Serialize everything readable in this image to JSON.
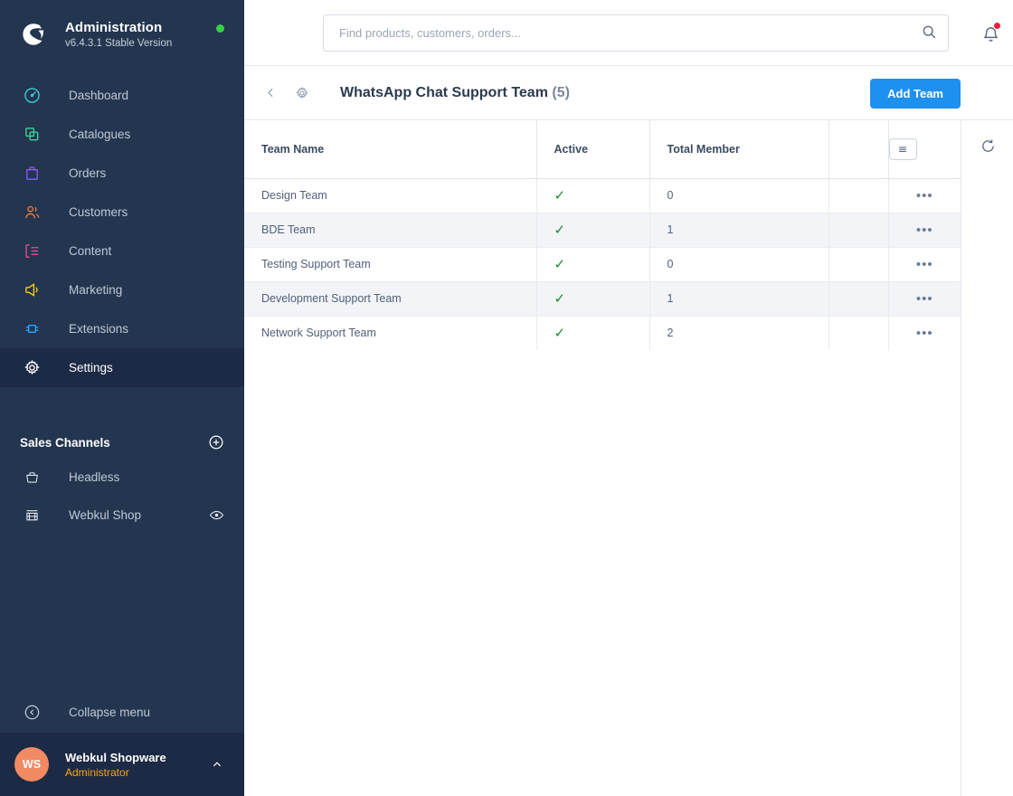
{
  "sidebar": {
    "brand": {
      "logo_icon": "shopware-logo-icon",
      "title": "Administration",
      "version": "v6.4.3.1 Stable Version",
      "status_dot_color": "#37d046"
    },
    "nav_items": [
      {
        "label": "Dashboard",
        "icon": "dashboard-icon",
        "color": "#3ecfd8",
        "active": false
      },
      {
        "label": "Catalogues",
        "icon": "catalogues-icon",
        "color": "#3ed598",
        "active": false
      },
      {
        "label": "Orders",
        "icon": "orders-icon",
        "color": "#8b5cf6",
        "active": false
      },
      {
        "label": "Customers",
        "icon": "customers-icon",
        "color": "#f0803c",
        "active": false
      },
      {
        "label": "Content",
        "icon": "content-icon",
        "color": "#ec4899",
        "active": false
      },
      {
        "label": "Marketing",
        "icon": "marketing-icon",
        "color": "#ffd400",
        "active": false
      },
      {
        "label": "Extensions",
        "icon": "extensions-icon",
        "color": "#2aa9ff",
        "active": false
      },
      {
        "label": "Settings",
        "icon": "settings-gear-icon",
        "color": "#ffffff",
        "active": true
      }
    ],
    "sales_channels": {
      "title": "Sales Channels",
      "add_icon": "plus-circle-icon",
      "items": [
        {
          "label": "Headless",
          "icon": "basket-icon",
          "has_eye": false
        },
        {
          "label": "Webkul Shop",
          "icon": "storefront-icon",
          "has_eye": true,
          "eye_icon": "eye-icon"
        }
      ]
    },
    "collapse": {
      "label": "Collapse menu",
      "icon": "collapse-left-icon"
    },
    "user": {
      "initials": "WS",
      "name": "Webkul Shopware",
      "role": "Administrator",
      "caret_icon": "chevron-up-icon",
      "avatar_color": "#f08a63",
      "role_color": "#ffa214"
    }
  },
  "topbar": {
    "search": {
      "placeholder": "Find products, customers, orders...",
      "value": "",
      "icon": "search-icon"
    },
    "notifications": {
      "icon": "bell-icon",
      "badge_color": "#e5203c",
      "has_badge": true
    }
  },
  "page_header": {
    "back_icon": "chevron-left-icon",
    "gear_icon": "gear-icon",
    "title": "WhatsApp Chat Support Team",
    "count": "(5)",
    "add_button": {
      "label": "Add Team",
      "color": "#1e90f0"
    }
  },
  "grid": {
    "columns": [
      {
        "label": "Team Name"
      },
      {
        "label": "Active"
      },
      {
        "label": "Total Member"
      },
      {
        "label": ""
      },
      {
        "label": ""
      }
    ],
    "header_menu_icon": "list-settings-icon",
    "context_menu_icon": "ellipsis-icon",
    "active_check_icon": "check-icon",
    "rows": [
      {
        "name": "Design Team",
        "active": "✓",
        "total": "0"
      },
      {
        "name": "BDE Team",
        "active": "✓",
        "total": "1"
      },
      {
        "name": "Testing Support Team",
        "active": "✓",
        "total": "0"
      },
      {
        "name": "Development Support Team",
        "active": "✓",
        "total": "1"
      },
      {
        "name": "Network Support Team",
        "active": "✓",
        "total": "2"
      }
    ]
  },
  "side_rail": {
    "refresh_icon": "refresh-icon"
  }
}
